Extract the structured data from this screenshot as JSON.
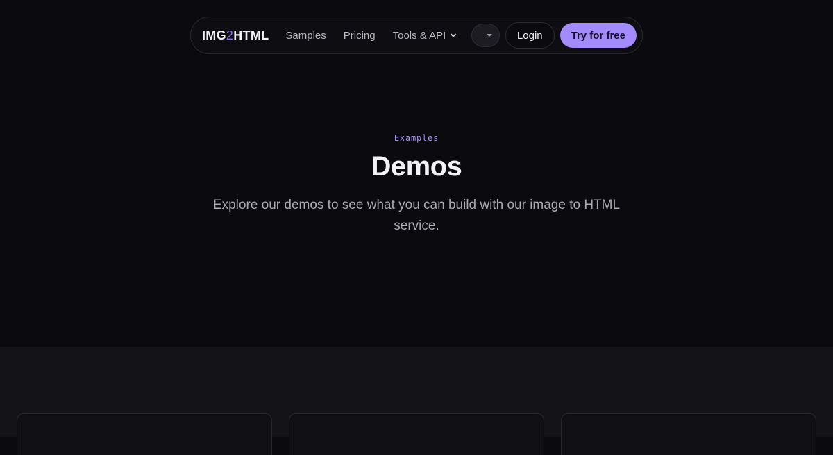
{
  "nav": {
    "logo": {
      "part1": "IMG",
      "part2": "2",
      "part3": "HTML"
    },
    "links": [
      {
        "label": "Samples"
      },
      {
        "label": "Pricing"
      },
      {
        "label": "Tools & API"
      }
    ],
    "login_label": "Login",
    "cta_label": "Try for free"
  },
  "hero": {
    "eyebrow": "Examples",
    "title": "Demos",
    "subtitle": "Explore our demos to see what you can build with our image to HTML service."
  },
  "colors": {
    "accent": "#a48bfb",
    "background": "#0b0b0f",
    "section_background": "#131318"
  }
}
